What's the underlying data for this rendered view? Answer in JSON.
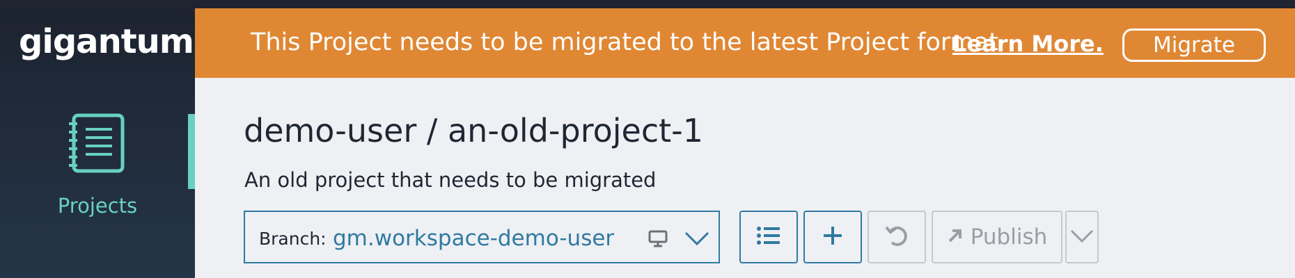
{
  "sidebar": {
    "logo": "gigantum",
    "nav_items": [
      {
        "label": "Projects",
        "icon": "notebook-icon",
        "active": true
      }
    ]
  },
  "banner": {
    "message": "This Project needs to be migrated to the latest Project format",
    "link_label": "Learn More.",
    "button_label": "Migrate"
  },
  "project": {
    "title": "demo-user / an-old-project-1",
    "description": "An old project that needs to be migrated"
  },
  "branch": {
    "prefix": "Branch:",
    "name": "gm.workspace-demo-user",
    "location_icon": "local-computer-icon"
  },
  "toolbar": {
    "branches_icon": "list-icon",
    "add_icon": "plus-icon",
    "sync_icon": "undo-icon",
    "publish_label": "Publish",
    "publish_icon": "arrow-up-right-icon",
    "more_icon": "chevron-down-icon"
  },
  "colors": {
    "sidebar_bg": "#1d2330",
    "accent_teal": "#69d1c0",
    "banner_orange": "#e08734",
    "primary_blue": "#2e7aa0",
    "disabled_gray": "#9a9da3",
    "page_bg": "#eff0f4",
    "text_dark": "#1f2733"
  }
}
